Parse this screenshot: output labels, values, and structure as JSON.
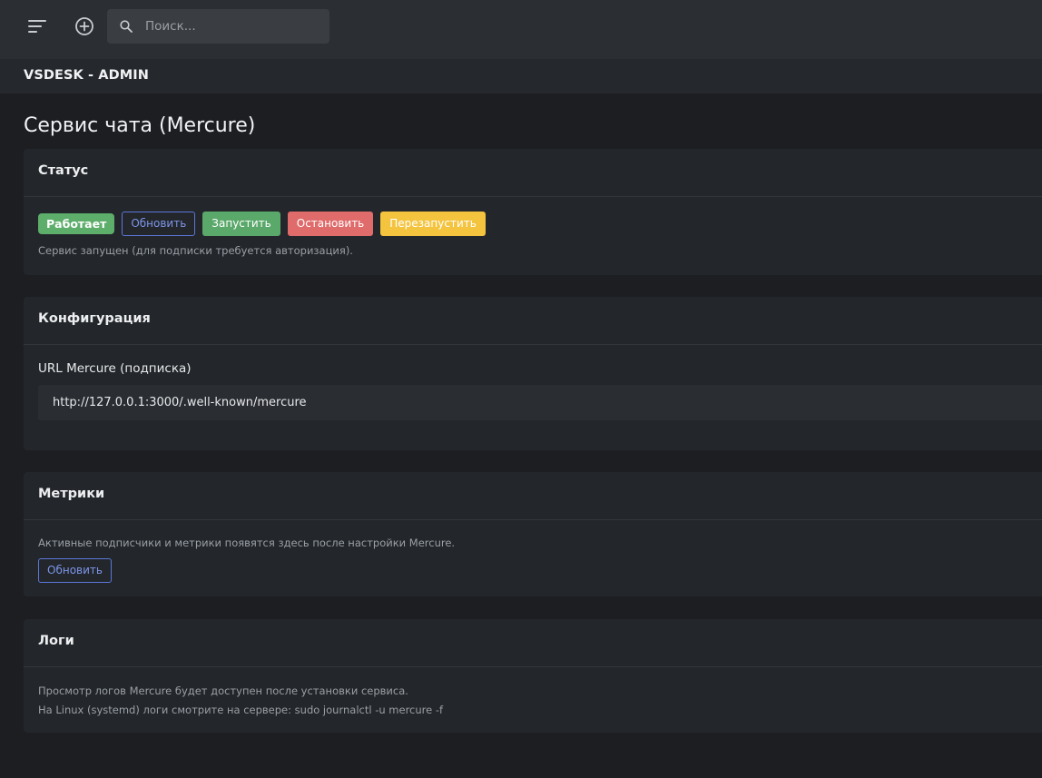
{
  "header": {
    "search_placeholder": "Поиск..."
  },
  "brand": "VSDESK - ADMIN",
  "page_title": "Сервис чата (Mercure)",
  "status_card": {
    "title": "Статус",
    "badge": "Работает",
    "buttons": {
      "refresh": "Обновить",
      "start": "Запустить",
      "stop": "Остановить",
      "restart": "Перезапустить"
    },
    "note": "Сервис запущен (для подписки требуется авторизация)."
  },
  "config_card": {
    "title": "Конфигурация",
    "url_label": "URL Mercure (подписка)",
    "url_value": "http://127.0.0.1:3000/.well-known/mercure"
  },
  "metrics_card": {
    "title": "Метрики",
    "note": "Активные подписчики и метрики появятся здесь после настройки Mercure.",
    "refresh": "Обновить"
  },
  "logs_card": {
    "title": "Логи",
    "line1": "Просмотр логов Mercure будет доступен после установки сервиса.",
    "line2": "На Linux (systemd) логи смотрите на сервере: sudo journalctl -u mercure -f"
  },
  "colors": {
    "success": "#5dad6b",
    "primary_outline": "#5c77d9",
    "danger": "#e06b6b",
    "warning": "#f4c43f"
  }
}
